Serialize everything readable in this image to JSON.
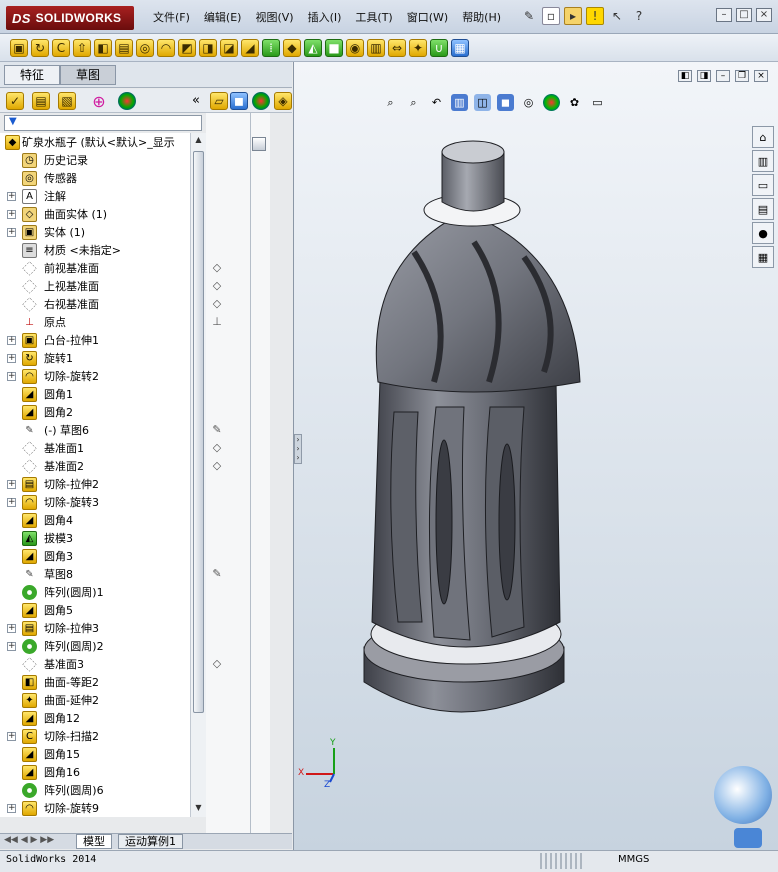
{
  "app": {
    "logo_text": "SOLIDWORKS",
    "logo_prefix": "DS"
  },
  "menu": [
    "文件(F)",
    "编辑(E)",
    "视图(V)",
    "插入(I)",
    "工具(T)",
    "窗口(W)",
    "帮助(H)"
  ],
  "left_tabs": [
    "特征",
    "草图"
  ],
  "tree": {
    "root": "矿泉水瓶子   (默认<默认>_显示",
    "items": [
      {
        "label": "历史记录",
        "expand": false,
        "icon": "history-icon",
        "sym": ""
      },
      {
        "label": "传感器",
        "expand": false,
        "icon": "sensor-icon",
        "sym": ""
      },
      {
        "label": "注解",
        "expand": true,
        "icon": "annotation-icon",
        "sym": ""
      },
      {
        "label": "曲面实体 (1)",
        "expand": true,
        "icon": "surface-body-icon",
        "sym": ""
      },
      {
        "label": "实体 (1)",
        "expand": true,
        "icon": "solid-body-icon",
        "sym": ""
      },
      {
        "label": "材质 <未指定>",
        "expand": false,
        "icon": "material-icon",
        "sym": ""
      },
      {
        "label": "前视基准面",
        "expand": false,
        "icon": "plane-icon",
        "sym": "plane"
      },
      {
        "label": "上视基准面",
        "expand": false,
        "icon": "plane-icon",
        "sym": "plane"
      },
      {
        "label": "右视基准面",
        "expand": false,
        "icon": "plane-icon",
        "sym": "plane"
      },
      {
        "label": "原点",
        "expand": false,
        "icon": "origin-icon",
        "sym": "origin"
      },
      {
        "label": "凸台-拉伸1",
        "expand": true,
        "icon": "extrude-boss-icon",
        "sym": ""
      },
      {
        "label": "旋转1",
        "expand": true,
        "icon": "revolve-icon",
        "sym": ""
      },
      {
        "label": "切除-旋转2",
        "expand": true,
        "icon": "cut-revolve-icon",
        "sym": ""
      },
      {
        "label": "圆角1",
        "expand": false,
        "icon": "fillet-icon",
        "sym": ""
      },
      {
        "label": "圆角2",
        "expand": false,
        "icon": "fillet-icon",
        "sym": ""
      },
      {
        "label": "(-) 草图6",
        "expand": false,
        "icon": "sketch-icon",
        "sym": "sketch"
      },
      {
        "label": "基准面1",
        "expand": false,
        "icon": "plane-icon",
        "sym": "plane"
      },
      {
        "label": "基准面2",
        "expand": false,
        "icon": "plane-icon",
        "sym": "plane"
      },
      {
        "label": "切除-拉伸2",
        "expand": true,
        "icon": "cut-extrude-icon",
        "sym": ""
      },
      {
        "label": "切除-旋转3",
        "expand": true,
        "icon": "cut-revolve-icon",
        "sym": ""
      },
      {
        "label": "圆角4",
        "expand": false,
        "icon": "fillet-icon",
        "sym": ""
      },
      {
        "label": "拔模3",
        "expand": false,
        "icon": "draft-icon",
        "sym": ""
      },
      {
        "label": "圆角3",
        "expand": false,
        "icon": "fillet-icon",
        "sym": ""
      },
      {
        "label": "草图8",
        "expand": false,
        "icon": "sketch-icon",
        "sym": "sketch"
      },
      {
        "label": "阵列(圆周)1",
        "expand": false,
        "icon": "circular-pattern-icon",
        "sym": ""
      },
      {
        "label": "圆角5",
        "expand": false,
        "icon": "fillet-icon",
        "sym": ""
      },
      {
        "label": "切除-拉伸3",
        "expand": true,
        "icon": "cut-extrude-icon",
        "sym": ""
      },
      {
        "label": "阵列(圆周)2",
        "expand": true,
        "icon": "circular-pattern-icon",
        "sym": ""
      },
      {
        "label": "基准面3",
        "expand": false,
        "icon": "plane-icon",
        "sym": "plane"
      },
      {
        "label": "曲面-等距2",
        "expand": false,
        "icon": "offset-surface-icon",
        "sym": ""
      },
      {
        "label": "曲面-延伸2",
        "expand": false,
        "icon": "extend-surface-icon",
        "sym": ""
      },
      {
        "label": "圆角12",
        "expand": false,
        "icon": "fillet-icon",
        "sym": ""
      },
      {
        "label": "切除-扫描2",
        "expand": true,
        "icon": "cut-sweep-icon",
        "sym": ""
      },
      {
        "label": "圆角15",
        "expand": false,
        "icon": "fillet-icon",
        "sym": ""
      },
      {
        "label": "圆角16",
        "expand": false,
        "icon": "fillet-icon",
        "sym": ""
      },
      {
        "label": "阵列(圆周)6",
        "expand": false,
        "icon": "circular-pattern-icon",
        "sym": ""
      },
      {
        "label": "切除-旋转9",
        "expand": true,
        "icon": "cut-revolve-icon",
        "sym": ""
      }
    ]
  },
  "bottom_tabs": [
    "模型",
    "运动算例1"
  ],
  "status": {
    "app": "SolidWorks 2014",
    "units": "MMGS"
  },
  "triad": {
    "x": "X",
    "y": "Y",
    "z": "Z"
  },
  "colors": {
    "accent_red": "#a82020",
    "part_gray": "#7d8088"
  }
}
